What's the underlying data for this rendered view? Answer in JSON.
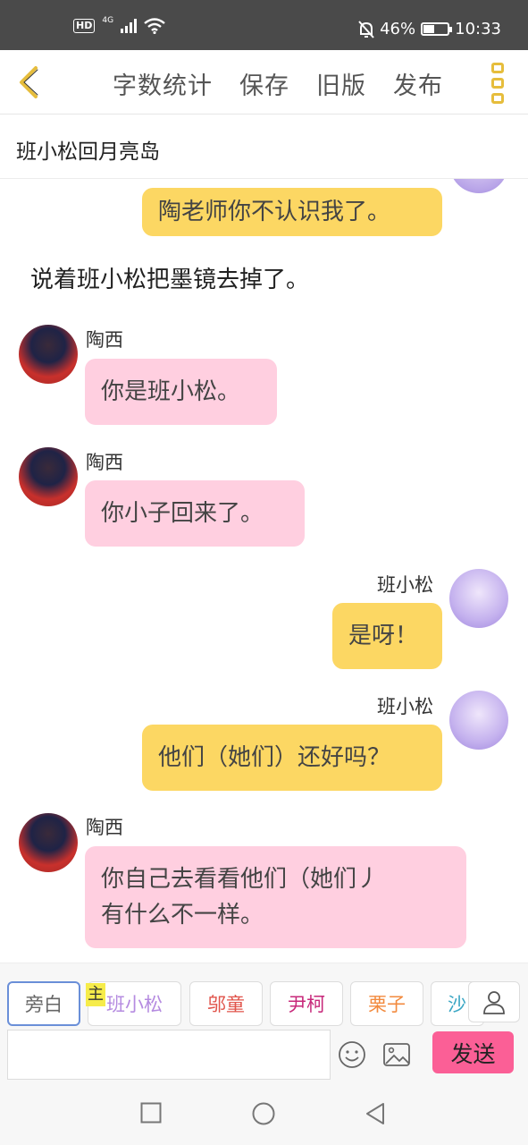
{
  "status_bar": {
    "network_hd": "HD",
    "network_4g": "4G",
    "battery": "46%",
    "battery_level": 0.46,
    "time": "10:33",
    "icons": [
      "signal-icon",
      "wifi-icon",
      "mute-bell-icon",
      "battery-icon"
    ]
  },
  "nav": {
    "back_icon": "chevron-left-icon",
    "word_count": "字数统计",
    "save": "保存",
    "old_version": "旧版",
    "publish": "发布",
    "more_icon": "more-vertical-icon",
    "accent_color": "#e6bd3c"
  },
  "story": {
    "title": "班小松回月亮岛"
  },
  "messages": {
    "m0": {
      "text": "陶老师你不认识我了。"
    },
    "narration": "说着班小松把墨镜去掉了。",
    "m1": {
      "name": "陶西",
      "text": "你是班小松。"
    },
    "m2": {
      "name": "陶西",
      "text": "你小子回来了。"
    },
    "m3": {
      "name": "班小松",
      "text": "是呀！"
    },
    "m4": {
      "name": "班小松",
      "text": "他们（她们）还好吗？"
    },
    "m5": {
      "name": "陶西",
      "line1": "你自己去看看他们（她们丿",
      "line2": "有什么不一样。"
    }
  },
  "colors": {
    "pink_bubble": "#ffcfe0",
    "yellow_bubble": "#fcd763",
    "send_button": "#fb5f96"
  },
  "characters": {
    "owner_badge": "主",
    "items": [
      {
        "label": "旁白",
        "color": "#666666"
      },
      {
        "label": "班小松",
        "color": "#b58be0"
      },
      {
        "label": "邬童",
        "color": "#e0534a"
      },
      {
        "label": "尹柯",
        "color": "#c7287a"
      },
      {
        "label": "栗子",
        "color": "#f28a3e"
      },
      {
        "label": "沙",
        "color": "#3aa6c4"
      }
    ]
  },
  "composer": {
    "placeholder": "",
    "emoji_icon": "smiley-icon",
    "image_icon": "image-icon",
    "send": "发送",
    "user_icon": "user-icon"
  },
  "system_nav": {
    "icons": [
      "recents-square-icon",
      "home-circle-icon",
      "back-triangle-icon"
    ]
  }
}
